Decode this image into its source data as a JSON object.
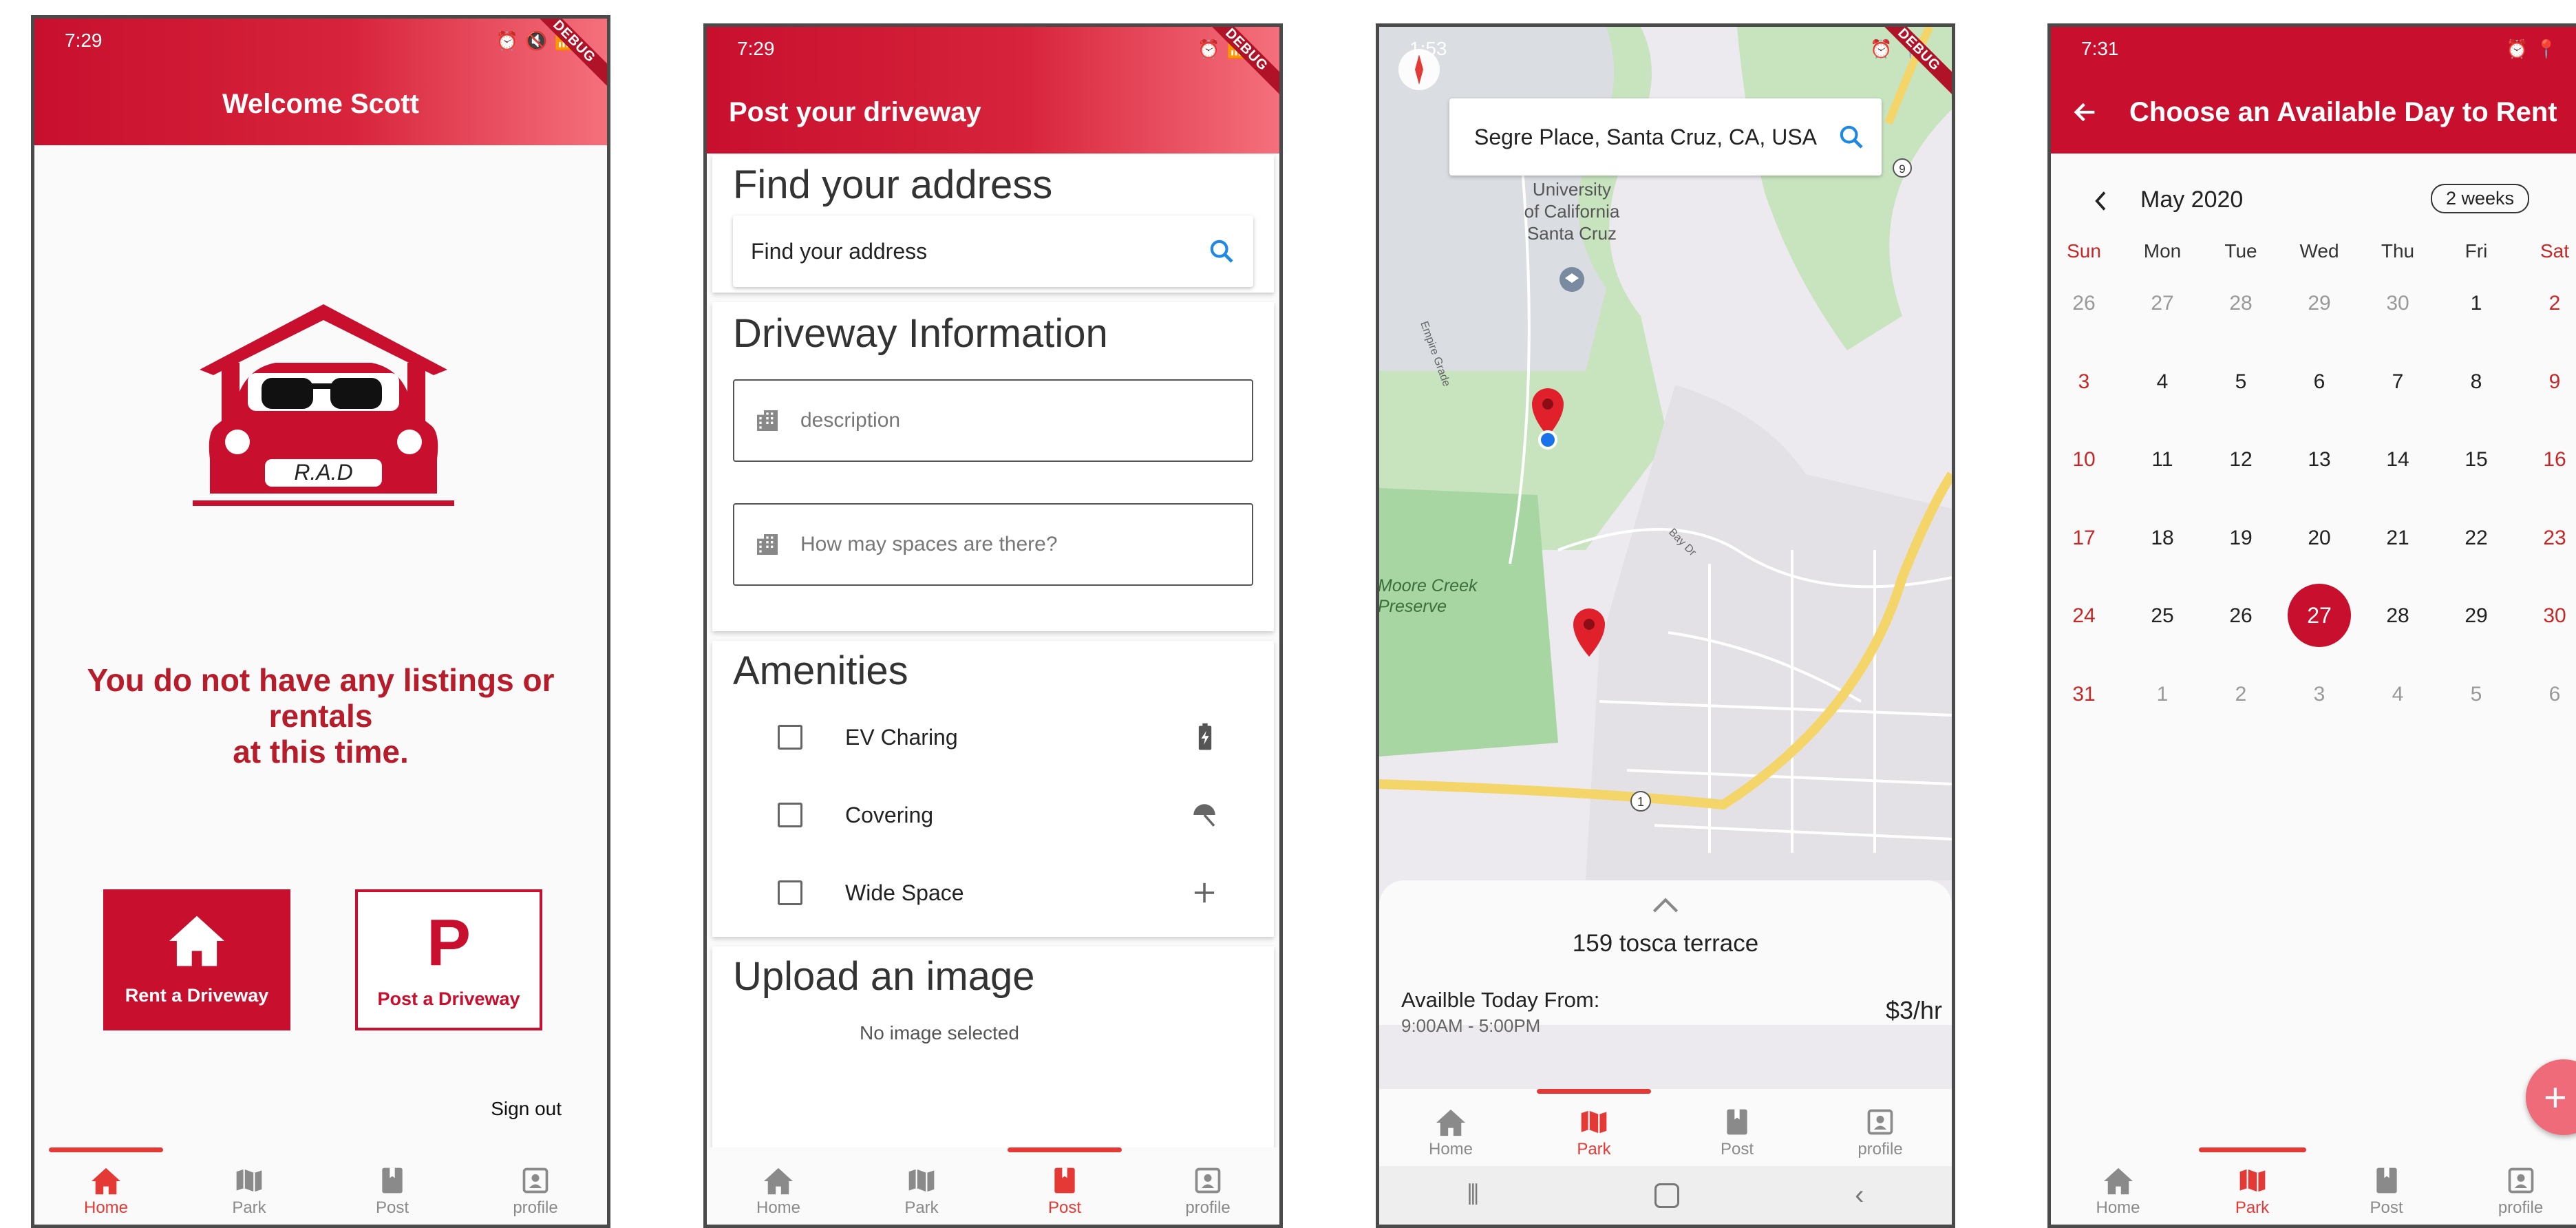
{
  "colors": {
    "primary": "#c8102e",
    "accent": "#e53935",
    "map_road": "#f4d56a",
    "map_park": "#c7e4bf"
  },
  "nav_items": [
    {
      "label": "Home",
      "icon": "home-icon"
    },
    {
      "label": "Park",
      "icon": "map-icon"
    },
    {
      "label": "Post",
      "icon": "book-icon"
    },
    {
      "label": "profile",
      "icon": "profile-icon"
    }
  ],
  "debug_label": "DEBUG",
  "screen1": {
    "time": "7:29",
    "title": "Welcome Scott",
    "logo_text": "R.A.D",
    "message_line1": "You do not have any listings or",
    "message_line2": "rentals",
    "message_line3": "at this time.",
    "rent_button": "Rent a Driveway",
    "post_button": "Post a Driveway",
    "post_button_letter": "P",
    "sign_out": "Sign out",
    "active_tab": 0
  },
  "screen2": {
    "time": "7:29",
    "title": "Post your driveway",
    "find_heading": "Find your address",
    "find_placeholder": "Find your address",
    "driveway_heading": "Driveway Information",
    "description_placeholder": "description",
    "spaces_placeholder": "How may spaces are there?",
    "amenities_heading": "Amenities",
    "amenities": [
      {
        "label": "EV Charing",
        "icon": "ev-charging-icon",
        "checked": false
      },
      {
        "label": "Covering",
        "icon": "umbrella-icon",
        "checked": false
      },
      {
        "label": "Wide Space",
        "icon": "plus-icon",
        "checked": false
      }
    ],
    "upload_heading": "Upload an image",
    "no_image": "No image selected",
    "active_tab": 2
  },
  "screen3": {
    "time": "1:53",
    "search_value": "Segre Place, Santa Cruz, CA, USA",
    "map_labels": {
      "campus": "University\nof California\nSanta Cruz",
      "preserve": "Moore Creek\nPreserve",
      "empire": "Empire Grade",
      "bay": "Bay Dr",
      "highway1": "1",
      "highway9": "9"
    },
    "address": "159 tosca terrace",
    "available_label": "Availble Today From:",
    "available_hours": "9:00AM - 5:00PM",
    "price": "$3/hr",
    "active_tab": 1
  },
  "screen4": {
    "time": "7:31",
    "title": "Choose an Available Day to Rent",
    "month": "May 2020",
    "format_button": "2 weeks",
    "weekdays": [
      "Sun",
      "Mon",
      "Tue",
      "Wed",
      "Thu",
      "Fri",
      "Sat"
    ],
    "weeks": [
      [
        "26",
        "27",
        "28",
        "29",
        "30",
        "1",
        "2"
      ],
      [
        "3",
        "4",
        "5",
        "6",
        "7",
        "8",
        "9"
      ],
      [
        "10",
        "11",
        "12",
        "13",
        "14",
        "15",
        "16"
      ],
      [
        "17",
        "18",
        "19",
        "20",
        "21",
        "22",
        "23"
      ],
      [
        "24",
        "25",
        "26",
        "27",
        "28",
        "29",
        "30"
      ],
      [
        "31",
        "1",
        "2",
        "3",
        "4",
        "5",
        "6"
      ]
    ],
    "selected_day": "27",
    "fab_label": "+",
    "active_tab": 1
  }
}
